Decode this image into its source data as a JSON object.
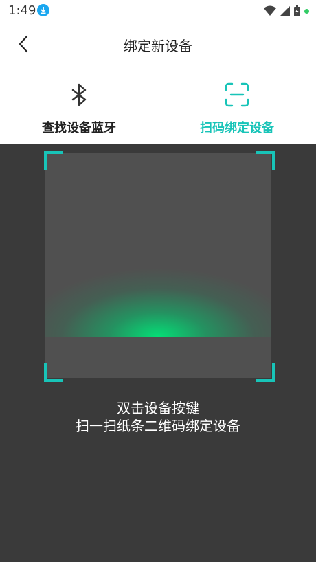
{
  "status_bar": {
    "time": "1:49",
    "icons": [
      "download-icon",
      "wifi-icon",
      "signal-icon",
      "battery-icon",
      "notification-dot-icon"
    ]
  },
  "header": {
    "title": "绑定新设备",
    "back_icon": "chevron-left-icon"
  },
  "tabs": [
    {
      "label": "查找设备蓝牙",
      "icon": "bluetooth-icon",
      "active": false
    },
    {
      "label": "扫码绑定设备",
      "icon": "scan-frame-icon",
      "active": true
    }
  ],
  "scanner": {
    "hint_line1": "双击设备按键",
    "hint_line2": "扫一扫纸条二维码绑定设备"
  },
  "colors": {
    "accent": "#18c4b8",
    "scan_glow": "#00e678",
    "background": "#3a3a3a",
    "viewfinder": "#505050"
  }
}
